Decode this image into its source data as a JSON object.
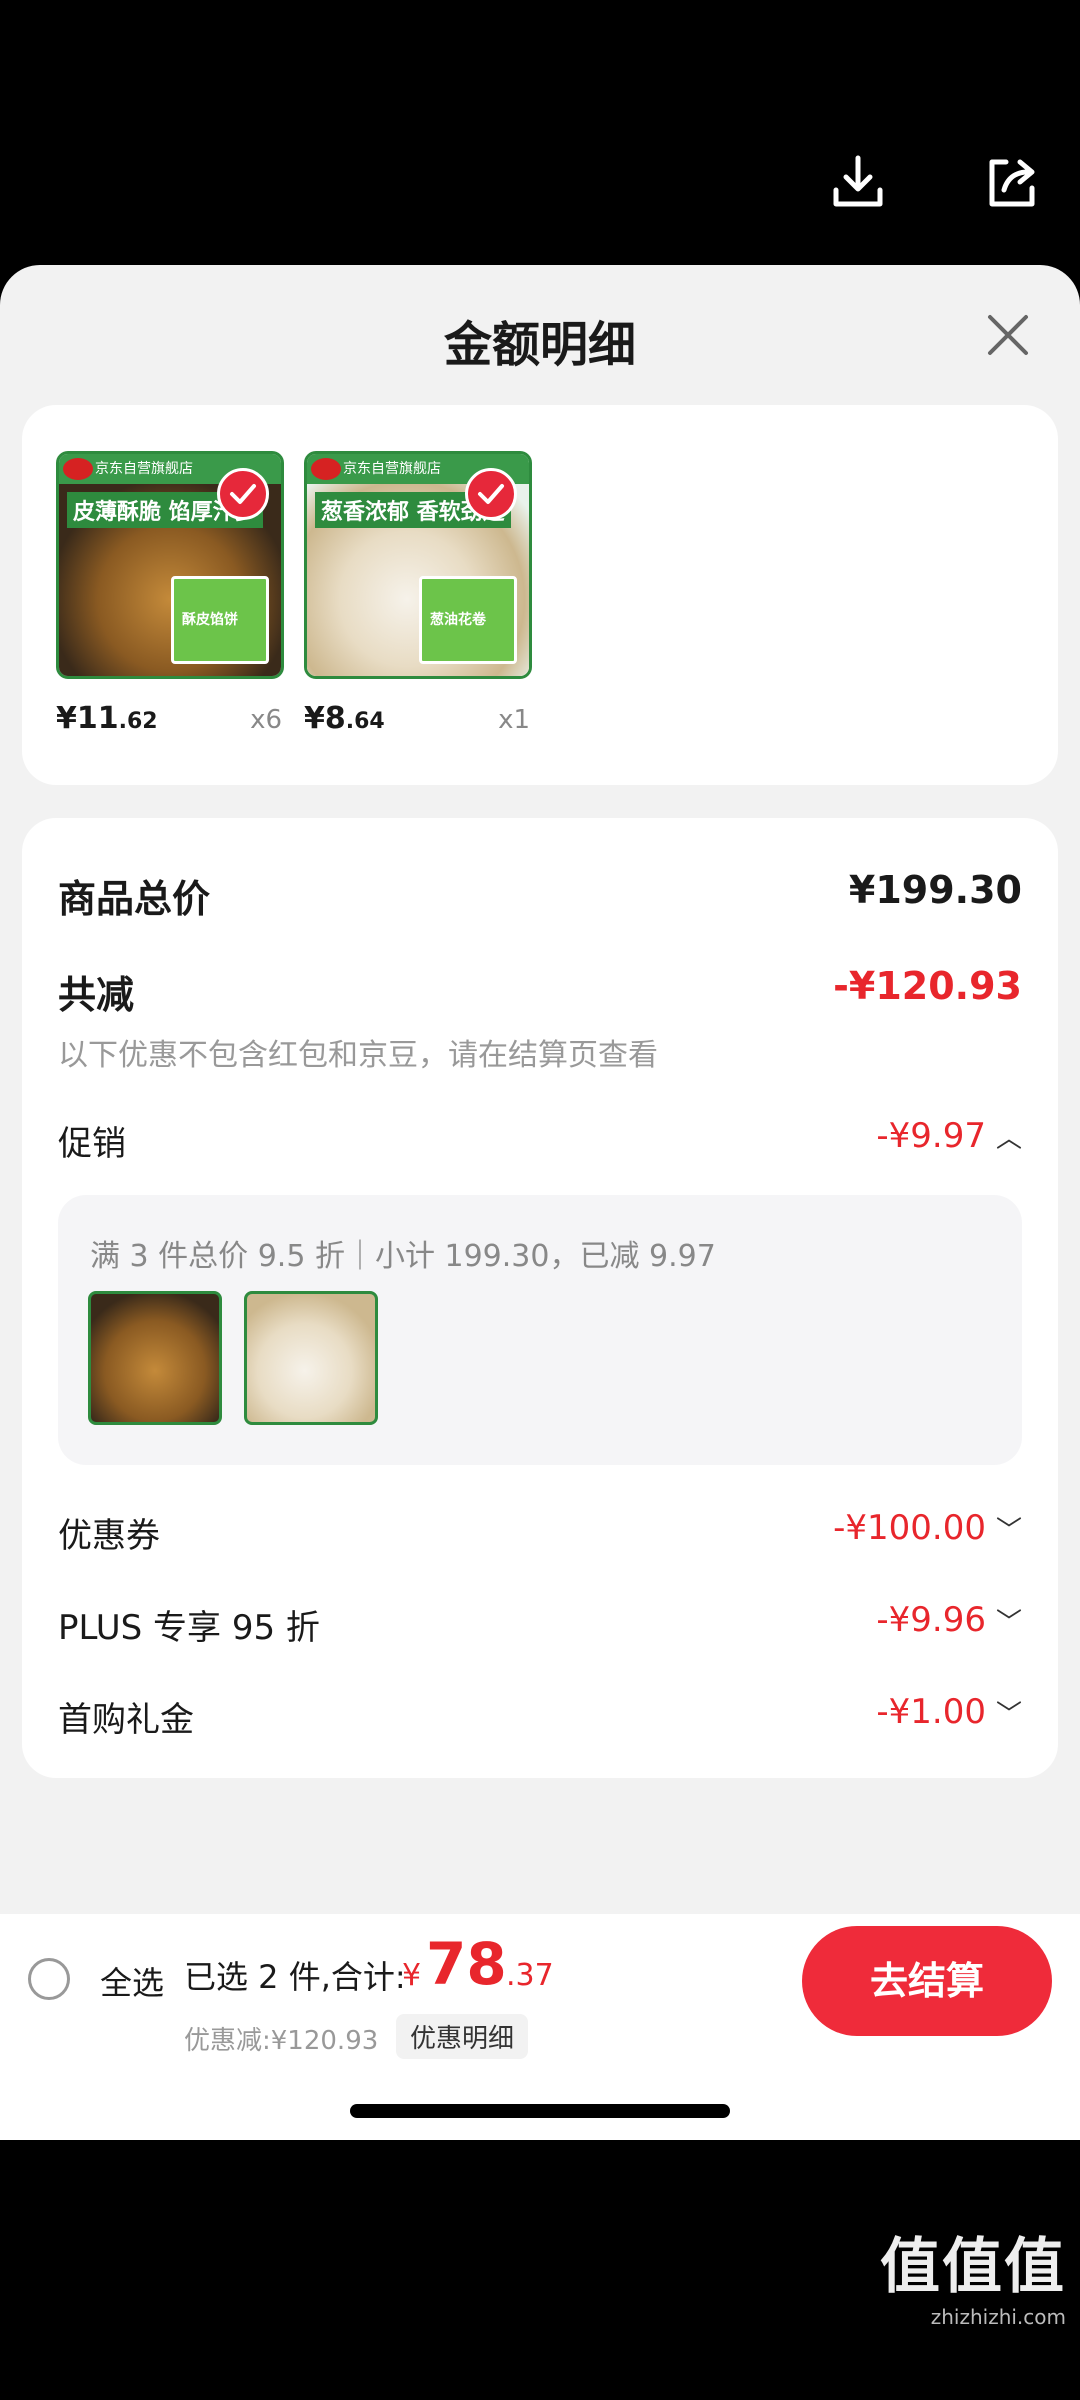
{
  "sheet": {
    "title": "金额明细"
  },
  "products": [
    {
      "store": "京东自营旗舰店",
      "banner": "皮薄酥脆 馅厚汁多",
      "pkg_label": "酥皮馅饼",
      "price_int": "¥11",
      "price_dec": ".62",
      "qty": "x6"
    },
    {
      "store": "京东自营旗舰店",
      "banner": "葱香浓郁 香软劲道",
      "pkg_label": "葱油花卷",
      "price_int": "¥8",
      "price_dec": ".64",
      "qty": "x1"
    }
  ],
  "summary": {
    "total_label": "商品总价",
    "total_value": "¥199.30",
    "reduce_label": "共减",
    "reduce_value": "-¥120.93",
    "note": "以下优惠不包含红包和京豆，请在结算页查看",
    "promo_label": "促销",
    "promo_value": "-¥9.97",
    "promo_detail": "满 3 件总价 9.5 折｜小计 199.30，已减 9.97",
    "coupon_label": "优惠券",
    "coupon_value": "-¥100.00",
    "plus_label": "PLUS 专享 95 折",
    "plus_value": "-¥9.96",
    "gift_label": "首购礼金",
    "gift_value": "-¥1.00"
  },
  "bottom": {
    "select_all": "全选",
    "selected_text": "已选 2 件,合计:",
    "total_currency": "¥",
    "total_int": "78",
    "total_dec": ".37",
    "discount_text": "优惠减:¥120.93",
    "detail_tag": "优惠明细",
    "checkout_label": "去结算"
  },
  "watermark": {
    "main": "值值值",
    "sub": "zhizhizhi.com"
  },
  "colors": {
    "accent": "#e8262c",
    "checkout": "#ef2b3a",
    "green": "#2e8b3e"
  },
  "icons": {
    "download": "download-icon",
    "share": "share-icon",
    "close": "close-icon"
  }
}
